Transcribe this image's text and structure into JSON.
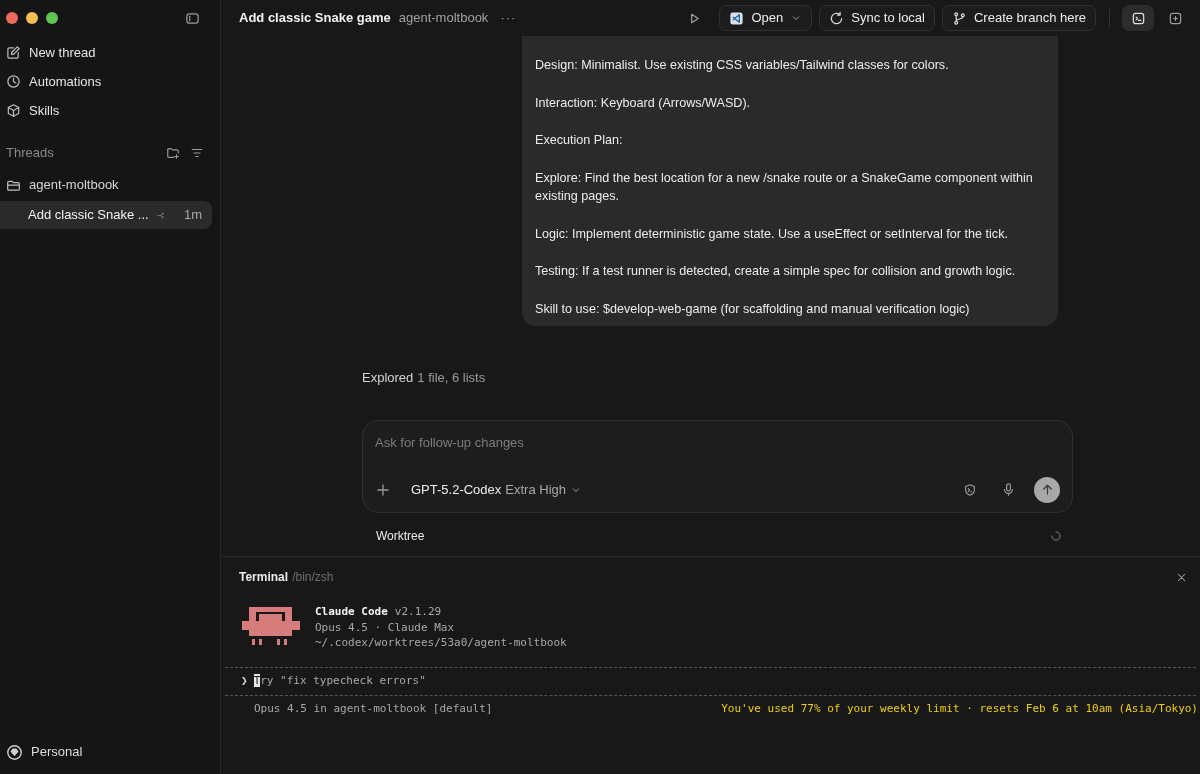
{
  "sidebar": {
    "nav": [
      {
        "label": "New thread",
        "kind": "compose"
      },
      {
        "label": "Automations",
        "kind": "clock"
      },
      {
        "label": "Skills",
        "kind": "cube"
      }
    ],
    "threads_label": "Threads",
    "projects": [
      {
        "label": "agent-moltbook",
        "threads": [
          {
            "title": "Add classic Snake ...",
            "time": "1m",
            "selected": true
          }
        ]
      }
    ],
    "account": "Personal"
  },
  "header": {
    "title": "Add classic Snake game",
    "project": "agent-moltbook",
    "more": "···",
    "buttons": [
      {
        "label": "Open",
        "kind": "editor"
      },
      {
        "label": "Sync to local",
        "kind": "sync"
      },
      {
        "label": "Create branch here",
        "kind": "branch"
      }
    ]
  },
  "message": {
    "paragraphs": [
      "Design: Minimalist. Use existing CSS variables/Tailwind classes for colors.",
      "Interaction: Keyboard (Arrows/WASD).",
      "Execution Plan:",
      "Explore: Find the best location for a new /snake route or a SnakeGame component within existing pages.",
      "Logic: Implement deterministic game state. Use a useEffect or setInterval for the tick.",
      "Testing: If a test runner is detected, create a simple spec for collision and growth logic.",
      "Skill to use: $develop-web-game (for scaffolding and manual verification logic)"
    ]
  },
  "activity": {
    "label": "Explored",
    "detail": "1 file, 6 lists"
  },
  "composer": {
    "placeholder": "Ask for follow-up changes",
    "model": "GPT-5.2-Codex",
    "effort": "Extra High"
  },
  "worktree": {
    "label": "Worktree"
  },
  "terminal": {
    "title": "Terminal",
    "shell": "/bin/zsh",
    "app": "Claude Code",
    "version": "v2.1.29",
    "lines": [
      "Opus 4.5 · Claude Max",
      "~/.codex/worktrees/53a0/agent-moltbook"
    ],
    "prompt": "❯",
    "input": "Try \"fix typecheck errors\"",
    "status_left": "Opus 4.5 in agent-moltbook [default]",
    "status_right": "You've used 77% of your weekly limit · resets Feb 6 at 10am (Asia/Tokyo)"
  }
}
